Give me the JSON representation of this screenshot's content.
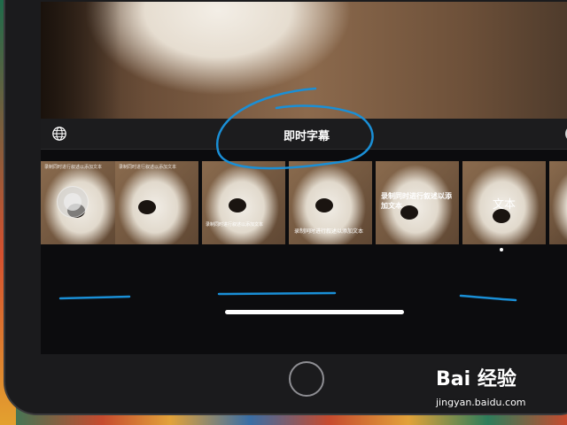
{
  "toolbar": {
    "title": "即时字幕",
    "left_icon": "globe-icon",
    "right_icon": "close-icon",
    "close_glyph": "×"
  },
  "thumbnails": [
    {
      "caption_top": "录制同时进行叙述以添加文本",
      "touch": true
    },
    {
      "caption_top": "录制同时进行叙述以添加文本"
    },
    {
      "caption_bottom": "录制同时进行叙述以添加文本"
    },
    {
      "caption_bottom2": "录制同时进行叙述以添加文本"
    },
    {
      "caption_mid": "录制同时进行叙述以添加文本"
    },
    {
      "caption_big": "文本"
    }
  ],
  "watermark": {
    "brand": "Bai 经验",
    "url": "jingyan.baidu.com"
  },
  "colors": {
    "annotation": "#1a8fd6",
    "accent_word": "#f2c94c"
  }
}
